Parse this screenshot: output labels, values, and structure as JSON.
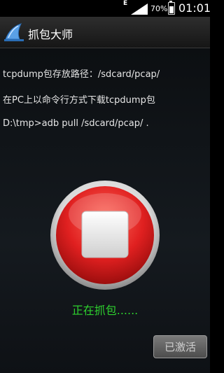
{
  "status_bar": {
    "network": "E",
    "battery": "70%",
    "battery_level": 0.7,
    "time": "01:01"
  },
  "app": {
    "title": "抓包大师",
    "icon": "shark-fin-icon"
  },
  "info_lines": [
    "tcpdump包存放路径：/sdcard/pcap/",
    "在PC上以命令行方式下载tcpdump包",
    "D:\\tmp>adb pull /sdcard/pcap/ ."
  ],
  "controls": {
    "stop_icon": "stop-button-icon",
    "status_text": "正在抓包......",
    "activate_label": "已激活"
  },
  "colors": {
    "status_text": "#2ed12e",
    "stop_button_red": "#e02020"
  }
}
